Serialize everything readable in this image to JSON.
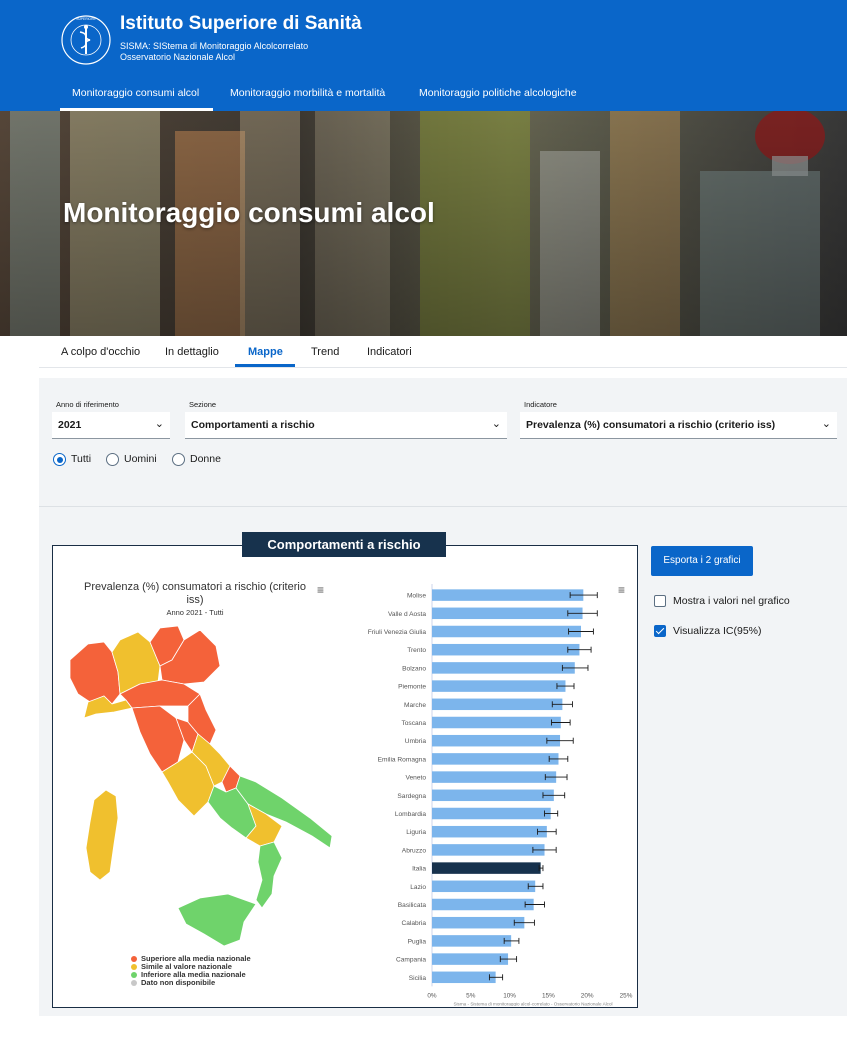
{
  "header": {
    "title": "Istituto Superiore di Sanità",
    "subtitle_line1": "SISMA: SIStema di Monitoraggio Alcolcorrelato",
    "subtitle_line2": "Osservatorio Nazionale Alcol",
    "seal_text": "ISTITUTO SUPERIORE DI SANITÀ",
    "nav": [
      {
        "label": "Monitoraggio consumi alcol",
        "active": true
      },
      {
        "label": "Monitoraggio morbilità e mortalità",
        "active": false
      },
      {
        "label": "Monitoraggio politiche alcologiche",
        "active": false
      }
    ]
  },
  "hero": {
    "title": "Monitoraggio consumi alcol"
  },
  "subtabs": [
    {
      "label": "A colpo d'occhio",
      "active": false
    },
    {
      "label": "In dettaglio",
      "active": false
    },
    {
      "label": "Mappe",
      "active": true
    },
    {
      "label": "Trend",
      "active": false
    },
    {
      "label": "Indicatori",
      "active": false
    }
  ],
  "filters": {
    "anno": {
      "label": "Anno di riferimento",
      "value": "2021"
    },
    "sezione": {
      "label": "Sezione",
      "value": "Comportamenti a rischio"
    },
    "indicatore": {
      "label": "Indicatore",
      "value": "Prevalenza (%) consumatori a rischio (criterio iss)"
    },
    "genere": [
      {
        "label": "Tutti",
        "selected": true
      },
      {
        "label": "Uomini",
        "selected": false
      },
      {
        "label": "Donne",
        "selected": false
      }
    ]
  },
  "panel": {
    "header": "Comportamenti a rischio",
    "export_label": "Esporta i 2 grafici",
    "show_values": {
      "label": "Mostra i valori nel grafico",
      "checked": false
    },
    "show_ci": {
      "label": "Visualizza IC(95%)",
      "checked": true
    }
  },
  "map": {
    "title_line1": "Prevalenza (%) consumatori a rischio (criterio",
    "title_line2": "iss)",
    "subtitle": "Anno 2021 - Tutti",
    "legend": [
      {
        "label": "Superiore alla media nazionale",
        "color": "#f4623a"
      },
      {
        "label": "Simile al valore nazionale",
        "color": "#f0c02e"
      },
      {
        "label": "Inferiore alla media nazionale",
        "color": "#6fd36b"
      },
      {
        "label": "Dato non disponibile",
        "color": "#c8c8c8"
      }
    ]
  },
  "chart_data": {
    "type": "bar",
    "orientation": "horizontal",
    "categories": [
      "Molise",
      "Valle d Aosta",
      "Friuli Venezia Giulia",
      "Trento",
      "Bolzano",
      "Piemonte",
      "Marche",
      "Toscana",
      "Umbria",
      "Emilia Romagna",
      "Veneto",
      "Sardegna",
      "Lombardia",
      "Liguria",
      "Abruzzo",
      "Italia",
      "Lazio",
      "Basilicata",
      "Calabria",
      "Puglia",
      "Campania",
      "Sicilia"
    ],
    "values": [
      19.5,
      19.4,
      19.2,
      19.0,
      18.4,
      17.2,
      16.8,
      16.6,
      16.5,
      16.3,
      16.0,
      15.7,
      15.3,
      14.8,
      14.5,
      14.0,
      13.3,
      13.1,
      11.9,
      10.2,
      9.8,
      8.2
    ],
    "ci_low": [
      17.8,
      17.5,
      17.6,
      17.5,
      16.8,
      16.1,
      15.5,
      15.4,
      14.8,
      15.1,
      14.6,
      14.3,
      14.5,
      13.6,
      13.0,
      13.8,
      12.4,
      12.0,
      10.6,
      9.3,
      8.8,
      7.4
    ],
    "ci_high": [
      21.3,
      21.3,
      20.8,
      20.5,
      20.1,
      18.3,
      18.1,
      17.8,
      18.2,
      17.5,
      17.4,
      17.1,
      16.2,
      16.0,
      16.0,
      14.3,
      14.3,
      14.5,
      13.2,
      11.2,
      10.9,
      9.1
    ],
    "highlight": "Italia",
    "bar_color": "#7cb5ec",
    "highlight_color": "#17324d",
    "x_ticks": [
      "0%",
      "5%",
      "10%",
      "15%",
      "20%",
      "25%"
    ],
    "xlim": [
      0,
      25
    ],
    "source": "Sisma - Sistema di monitoraggio alcol-correlato - Osservatorio Nazionale Alcol"
  }
}
